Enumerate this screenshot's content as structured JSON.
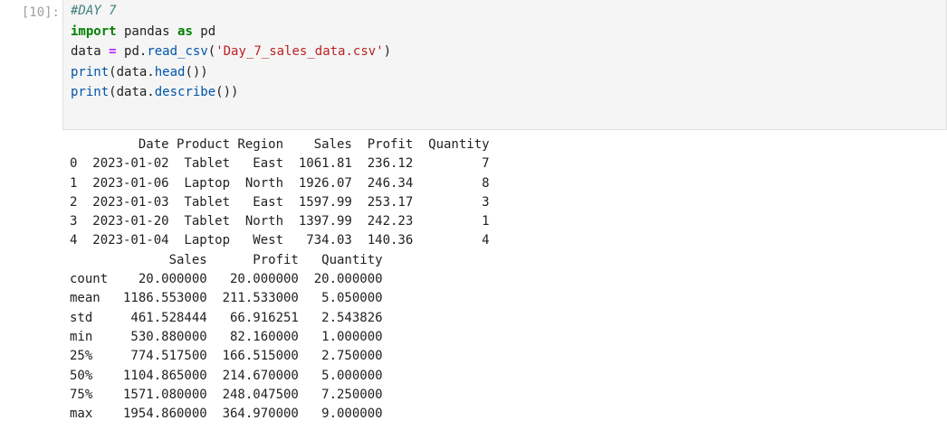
{
  "cell": {
    "prompt": "[10]:",
    "code_lines": [
      [
        {
          "t": "#DAY 7",
          "c": "cm"
        }
      ],
      [
        {
          "t": "import",
          "c": "kw"
        },
        {
          "t": " pandas ",
          "c": ""
        },
        {
          "t": "as",
          "c": "kw"
        },
        {
          "t": " pd",
          "c": ""
        }
      ],
      [
        {
          "t": "data ",
          "c": ""
        },
        {
          "t": "=",
          "c": "op"
        },
        {
          "t": " pd.",
          "c": ""
        },
        {
          "t": "read_csv",
          "c": "fn"
        },
        {
          "t": "(",
          "c": ""
        },
        {
          "t": "'Day_7_sales_data.csv'",
          "c": "st"
        },
        {
          "t": ")",
          "c": ""
        }
      ],
      [
        {
          "t": "print",
          "c": "fn"
        },
        {
          "t": "(data.",
          "c": ""
        },
        {
          "t": "head",
          "c": "fn"
        },
        {
          "t": "())",
          "c": ""
        }
      ],
      [
        {
          "t": "print",
          "c": "fn"
        },
        {
          "t": "(data.",
          "c": ""
        },
        {
          "t": "describe",
          "c": "fn"
        },
        {
          "t": "())",
          "c": ""
        }
      ]
    ]
  },
  "output": {
    "head_table": [
      "         Date Product Region    Sales  Profit  Quantity",
      "0  2023-01-02  Tablet   East  1061.81  236.12         7",
      "1  2023-01-06  Laptop  North  1926.07  246.34         8",
      "2  2023-01-03  Tablet   East  1597.99  253.17         3",
      "3  2023-01-20  Tablet  North  1397.99  242.23         1",
      "4  2023-01-04  Laptop   West   734.03  140.36         4"
    ],
    "describe_table": [
      "             Sales      Profit   Quantity",
      "count    20.000000   20.000000  20.000000",
      "mean   1186.553000  211.533000   5.050000",
      "std     461.528444   66.916251   2.543826",
      "min     530.880000   82.160000   1.000000",
      "25%     774.517500  166.515000   2.750000",
      "50%    1104.865000  214.670000   5.000000",
      "75%    1571.080000  248.047500   7.250000",
      "max    1954.860000  364.970000   9.000000"
    ]
  }
}
